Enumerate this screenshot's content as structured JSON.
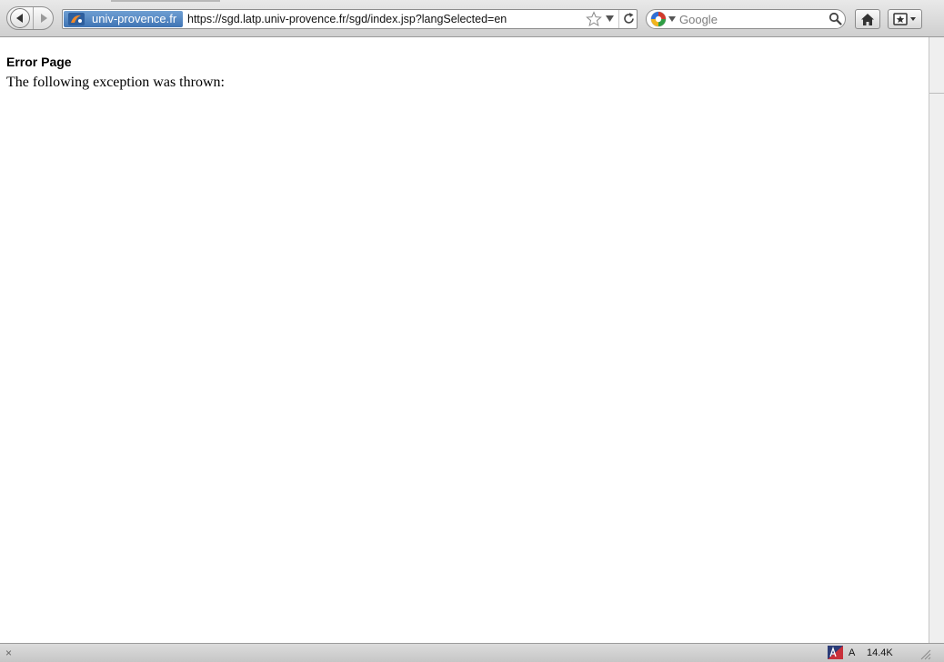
{
  "toolbar": {
    "identity_label": "univ-provence.fr",
    "url": "https://sgd.latp.univ-provence.fr/sgd/index.jsp?langSelected=en",
    "search_placeholder": "Google"
  },
  "page": {
    "title": "Error Page",
    "message": "The following exception was thrown:"
  },
  "statusbar": {
    "close_glyph": "×",
    "indicator": "A",
    "size": "14.4K"
  },
  "icons": {
    "back": "back-arrow-icon",
    "forward": "forward-arrow-icon",
    "favicon": "site-favicon",
    "bookmark": "star-icon",
    "history": "chevron-down-icon",
    "reload": "reload-icon",
    "search_engine": "google-icon",
    "search": "search-icon",
    "home": "home-icon",
    "bookmarks_menu": "bookmarks-icon"
  },
  "colors": {
    "identity_bg": "#4a7fbf",
    "page_bg": "#ffffff",
    "toolbar_bg": "#dcdcdc"
  }
}
